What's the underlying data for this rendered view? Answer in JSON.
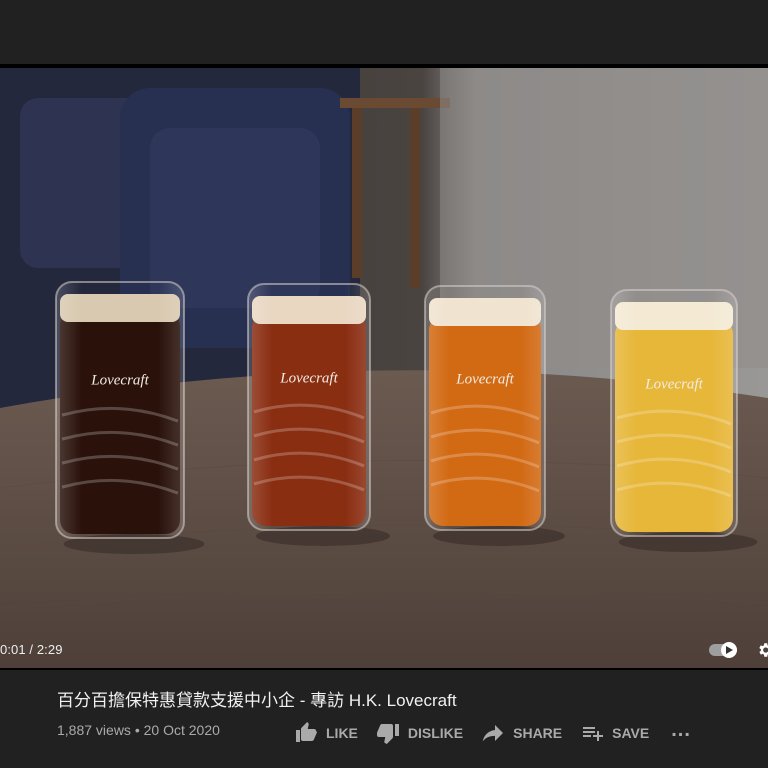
{
  "player": {
    "current_time": "0:01",
    "duration": "2:29",
    "time_separator": " / ",
    "progress_fraction": 0.007,
    "autoplay_on": true,
    "frame": {
      "glasses": [
        {
          "logo_text": "Lovecraft",
          "beer_color": "#2a120b",
          "foam_color": "#d9c9b0"
        },
        {
          "logo_text": "Lovecraft",
          "beer_color": "#8a2e12",
          "foam_color": "#e9d7c2"
        },
        {
          "logo_text": "Lovecraft",
          "beer_color": "#d26a14",
          "foam_color": "#f0e3cf"
        },
        {
          "logo_text": "Lovecraft",
          "beer_color": "#e7b73a",
          "foam_color": "#f4ead4"
        }
      ]
    }
  },
  "video": {
    "title": "百分百擔保特惠貸款支援中小企 - 專訪 H.K. Lovecraft",
    "views": "1,887 views",
    "separator": " • ",
    "date": "20 Oct 2020"
  },
  "actions": {
    "like_label": "LIKE",
    "dislike_label": "DISLIKE",
    "share_label": "SHARE",
    "save_label": "SAVE",
    "more_label": "..."
  },
  "icons": {
    "like": "thumbs-up-icon",
    "dislike": "thumbs-down-icon",
    "share": "share-arrow-icon",
    "save": "playlist-add-icon",
    "settings": "gear-icon",
    "autoplay": "play-icon"
  },
  "colors": {
    "page_bg": "#212121",
    "progress": "#ff0000",
    "secondary_text": "#aaaaaa"
  }
}
